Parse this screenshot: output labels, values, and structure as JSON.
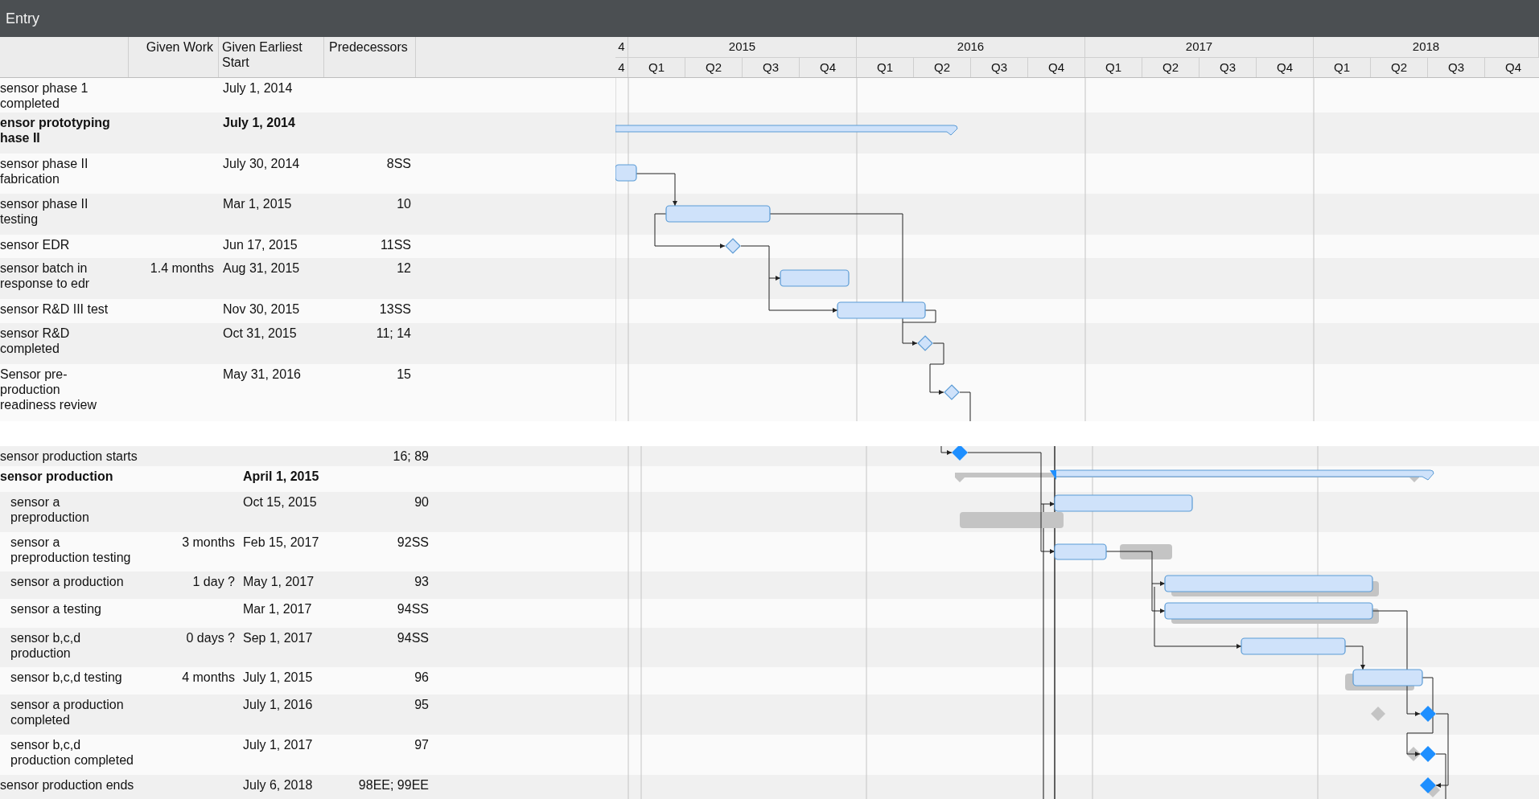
{
  "window": {
    "title": "Entry"
  },
  "columns": [
    "Given Work",
    "Given Earliest Start",
    "Predecessors"
  ],
  "timeline": {
    "years": [
      "4",
      "2015",
      "2016",
      "2017",
      "2018"
    ],
    "quarters": [
      "4",
      "Q1",
      "Q2",
      "Q3",
      "Q4",
      "Q1",
      "Q2",
      "Q3",
      "Q4",
      "Q1",
      "Q2",
      "Q3",
      "Q4",
      "Q1",
      "Q2",
      "Q3",
      "Q4"
    ]
  },
  "top_rows": [
    {
      "summary": false,
      "name": "sensor phase 1 completed",
      "start": "July 1, 2014"
    },
    {
      "summary": true,
      "name": "ensor prototyping hase II",
      "start": "July 1, 2014"
    },
    {
      "summary": false,
      "name": "sensor phase II fabrication",
      "start": "July 30, 2014",
      "predecessors": "8SS"
    },
    {
      "summary": false,
      "name": "sensor phase II testing",
      "start": "Mar 1, 2015",
      "predecessors": "10"
    },
    {
      "summary": false,
      "name": "sensor EDR",
      "start": "Jun 17, 2015",
      "predecessors": "11SS"
    },
    {
      "summary": false,
      "name": "sensor batch in response to edr",
      "work": "1.4 months",
      "start": "Aug 31, 2015",
      "predecessors": "12"
    },
    {
      "summary": false,
      "name": "sensor R&D III test",
      "start": "Nov 30, 2015",
      "predecessors": "13SS"
    },
    {
      "summary": false,
      "name": "sensor R&D completed",
      "start": "Oct 31, 2015",
      "predecessors": "11; 14"
    },
    {
      "summary": false,
      "name": "Sensor pre-production readiness review",
      "start": "May 31, 2016",
      "predecessors": "15"
    }
  ],
  "bottom_rows": [
    {
      "summary": false,
      "name": "sensor production starts",
      "predecessors": "16; 89"
    },
    {
      "summary": true,
      "name": "sensor production",
      "start": "April 1, 2015",
      "children": [
        {
          "summary": false,
          "name": "sensor a preproduction",
          "start": "Oct 15, 2015",
          "predecessors": "90"
        },
        {
          "summary": false,
          "name": "sensor a preproduction testing",
          "work": "3 months",
          "start": "Feb 15, 2017",
          "predecessors": "92SS"
        },
        {
          "summary": false,
          "name": "sensor a production",
          "work": "1 day ?",
          "start": "May 1, 2017",
          "predecessors": "93"
        },
        {
          "summary": false,
          "name": "sensor a testing",
          "start": "Mar 1, 2017",
          "predecessors": "94SS"
        },
        {
          "summary": false,
          "name": "sensor b,c,d production",
          "work": "0 days ?",
          "start": "Sep 1, 2017",
          "predecessors": "94SS"
        },
        {
          "summary": false,
          "name": "sensor b,c,d testing",
          "work": "4 months",
          "start": "July 1, 2015",
          "predecessors": "96"
        },
        {
          "summary": false,
          "name": "sensor a production completed",
          "start": "July 1, 2016",
          "predecessors": "95"
        },
        {
          "summary": false,
          "name": "sensor b,c,d production completed",
          "start": "July 1, 2017",
          "predecessors": "97"
        }
      ]
    },
    {
      "summary": false,
      "name": "sensor production ends",
      "start": "July 6, 2018",
      "predecessors": "98EE; 99EE"
    }
  ]
}
